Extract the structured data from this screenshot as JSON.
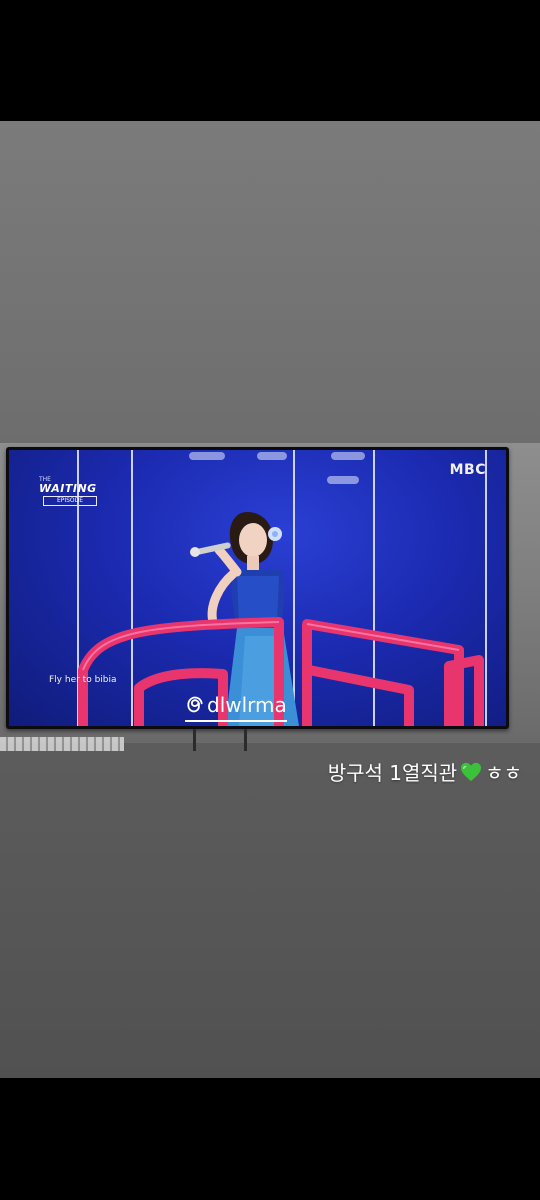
{
  "story": {
    "tv": {
      "show_logo": {
        "sub": "THE",
        "main": "WAITING",
        "tag": "EPISODE"
      },
      "broadcaster": "MBC",
      "subtitle": "Fly her to bibia"
    },
    "caption": {
      "text": "방구석 1열직관",
      "emoji": "green-heart-icon",
      "suffix": "ㅎㅎ"
    },
    "mention": {
      "icon": "threads-icon",
      "handle": "dlwlrma"
    }
  },
  "colors": {
    "screen_blue": "#1b2ab0",
    "stage_pink": "#e8356e",
    "heart_green": "#3cc23a",
    "text": "#ffffff"
  }
}
